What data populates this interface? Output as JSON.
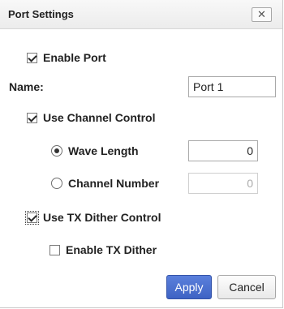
{
  "dialog": {
    "title": "Port Settings",
    "close_glyph": "✕",
    "enable_port": {
      "label": "Enable Port",
      "checked": true
    },
    "name": {
      "label": "Name:",
      "value": "Port 1"
    },
    "use_channel_control": {
      "label": "Use Channel Control",
      "checked": true
    },
    "wave_length": {
      "label": "Wave Length",
      "selected": true,
      "value": "0"
    },
    "channel_number": {
      "label": "Channel Number",
      "selected": false,
      "value": "0"
    },
    "use_tx_dither_control": {
      "label": "Use TX Dither Control",
      "checked": true
    },
    "enable_tx_dither": {
      "label": "Enable TX Dither",
      "checked": false
    },
    "buttons": {
      "apply": "Apply",
      "cancel": "Cancel"
    },
    "colors": {
      "apply_bg": "#4a6fd1",
      "title_bg": "#f1f1f1"
    }
  }
}
